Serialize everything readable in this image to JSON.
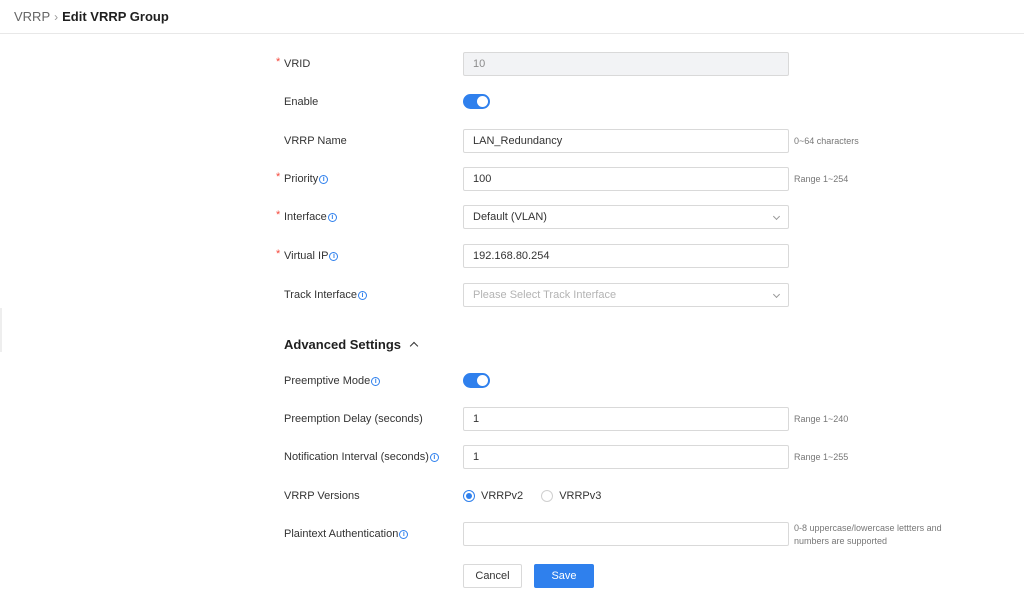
{
  "breadcrumb": {
    "parent": "VRRP",
    "separator": "›",
    "current": "Edit VRRP Group"
  },
  "fields": {
    "vrid": {
      "label": "VRID",
      "required": "*",
      "value": "10"
    },
    "enable": {
      "label": "Enable",
      "state": "on"
    },
    "vrrp_name": {
      "label": "VRRP Name",
      "value": "LAN_Redundancy",
      "hint": "0~64 characters"
    },
    "priority": {
      "label": "Priority",
      "required": "*",
      "value": "100",
      "hint": "Range 1~254"
    },
    "interface": {
      "label": "Interface",
      "required": "*",
      "value": "Default (VLAN)"
    },
    "virtual_ip": {
      "label": "Virtual IP",
      "required": "*",
      "value": "192.168.80.254"
    },
    "track_interface": {
      "label": "Track Interface",
      "placeholder": "Please Select Track Interface"
    }
  },
  "advanced": {
    "title": "Advanced Settings",
    "preemptive_mode": {
      "label": "Preemptive Mode",
      "state": "on"
    },
    "preemption_delay": {
      "label": "Preemption Delay (seconds)",
      "value": "1",
      "hint": "Range 1~240"
    },
    "notification_interval": {
      "label": "Notification Interval (seconds)",
      "value": "1",
      "hint": "Range 1~255"
    },
    "vrrp_versions": {
      "label": "VRRP Versions",
      "options": [
        "VRRPv2",
        "VRRPv3"
      ],
      "selected": "VRRPv2"
    },
    "plaintext_auth": {
      "label": "Plaintext Authentication",
      "value": "",
      "hint": "0-8 uppercase/lowercase lettters and numbers are supported"
    }
  },
  "buttons": {
    "cancel": "Cancel",
    "save": "Save"
  },
  "colors": {
    "accent": "#2f80ed",
    "required": "#f5483c"
  },
  "icons": {
    "info": "info-icon",
    "dropdown": "chevron-down-icon",
    "collapse": "chevron-up-icon"
  }
}
